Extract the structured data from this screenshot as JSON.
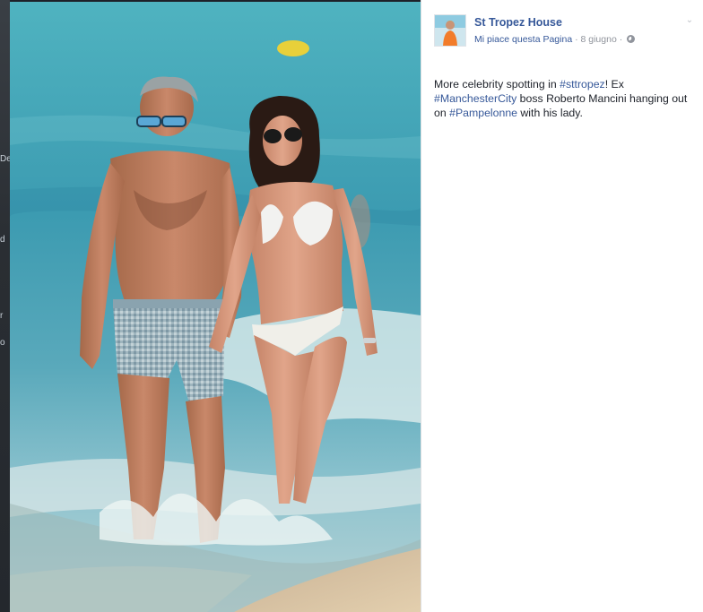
{
  "post": {
    "page_name": "St Tropez House",
    "like_label": "Mi piace questa Pagina",
    "separator": "·",
    "date": "8 giugno",
    "text": {
      "part1": "More celebrity spotting in ",
      "hashtag1": "#sttropez",
      "part2": "! Ex ",
      "hashtag2": "#ManchesterCity",
      "part3": " boss Roberto Mancini hanging out on ",
      "hashtag3": "#Pampelonne",
      "part4": " with his lady."
    }
  },
  "icons": {
    "audience": "globe-icon",
    "options": "chevron-down-icon"
  },
  "colors": {
    "link": "#365899",
    "meta": "#90949c",
    "text": "#1d2129",
    "sea": "#4aa3b5",
    "sand": "#d8c3a5"
  },
  "left_peek": [
    "De",
    "d",
    "r",
    "o"
  ]
}
